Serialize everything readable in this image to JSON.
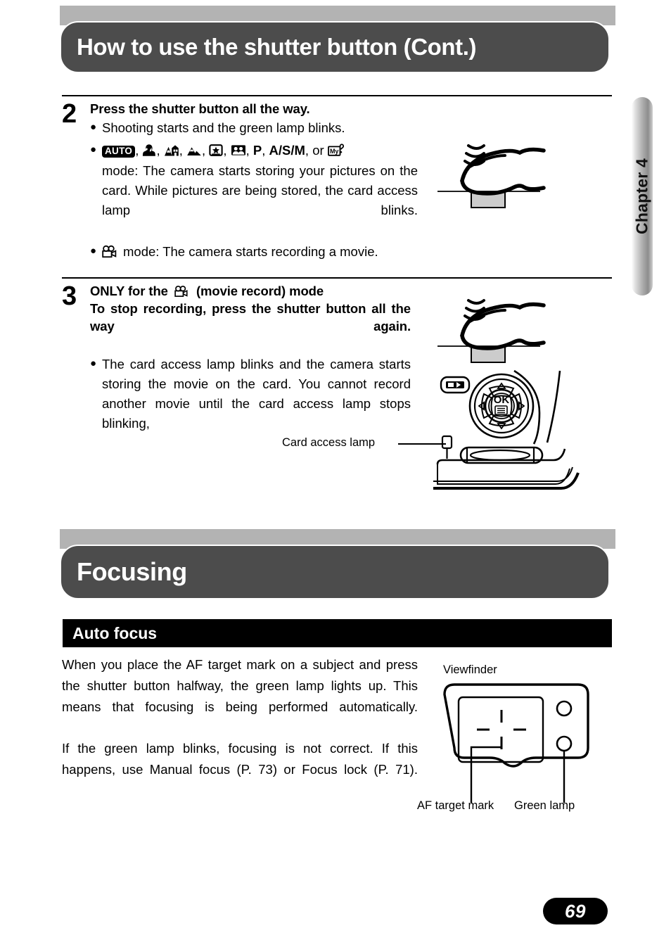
{
  "page": {
    "number": "69",
    "chapter_tab": "Chapter 4"
  },
  "chapter_header": {
    "title": "How to use the shutter button (Cont.)"
  },
  "steps": [
    {
      "number": "2",
      "title": "Press the shutter button all the way.",
      "bullets": [
        {
          "text": "Shooting starts and the green lamp blinks."
        },
        {
          "prefix": "",
          "icons": [
            "AUTO",
            "portrait",
            "portrait-landscape",
            "landscape",
            "night-scene",
            "self-portrait",
            "P",
            "A/S/M"
          ],
          "mid_text": "or",
          "mid_icon": "my-mode",
          "text": "mode: The camera starts storing your pictures on the card. While pictures are being stored, the card access lamp blinks."
        },
        {
          "icon": "movie",
          "text": "mode: The camera starts recording a movie."
        }
      ]
    },
    {
      "number": "3",
      "title_part1": "ONLY for the",
      "title_icon": "movie",
      "title_part2": "(movie record) mode",
      "title_line2": "To stop recording, press the shutter button all the way again.",
      "bullets": [
        {
          "text": "The card access lamp blinks and the camera starts storing the movie on the card. You cannot record another movie until the card access lamp stops blinking,"
        }
      ]
    }
  ],
  "mode_icon_labels": {
    "AUTO": "AUTO",
    "P": "P",
    "ASM": "A/S/M",
    "my": "My",
    "comma": ","
  },
  "camera_diagram": {
    "card_access_lamp_label": "Card access lamp",
    "ok_button_label": "OK"
  },
  "focusing_header": {
    "title": "Focusing"
  },
  "auto_focus": {
    "subheading": "Auto focus",
    "paragraph1": "When you place the AF target mark on a subject and press the shutter button halfway, the green lamp lights up. This means that focusing is being performed automatically.",
    "paragraph2": "If the green lamp blinks, focusing is not correct. If this happens, use Manual focus (P. 73) or Focus lock (P. 71)."
  },
  "viewfinder_diagram": {
    "title": "Viewfinder",
    "af_target_label": "AF target mark",
    "green_lamp_label": "Green lamp"
  },
  "colors": {
    "header_bar": "#4c4c4c",
    "header_backdrop": "#b3b3b3",
    "subheading_bar": "#000000",
    "shutter_button": "#cccccc",
    "page_badge": "#000000"
  }
}
